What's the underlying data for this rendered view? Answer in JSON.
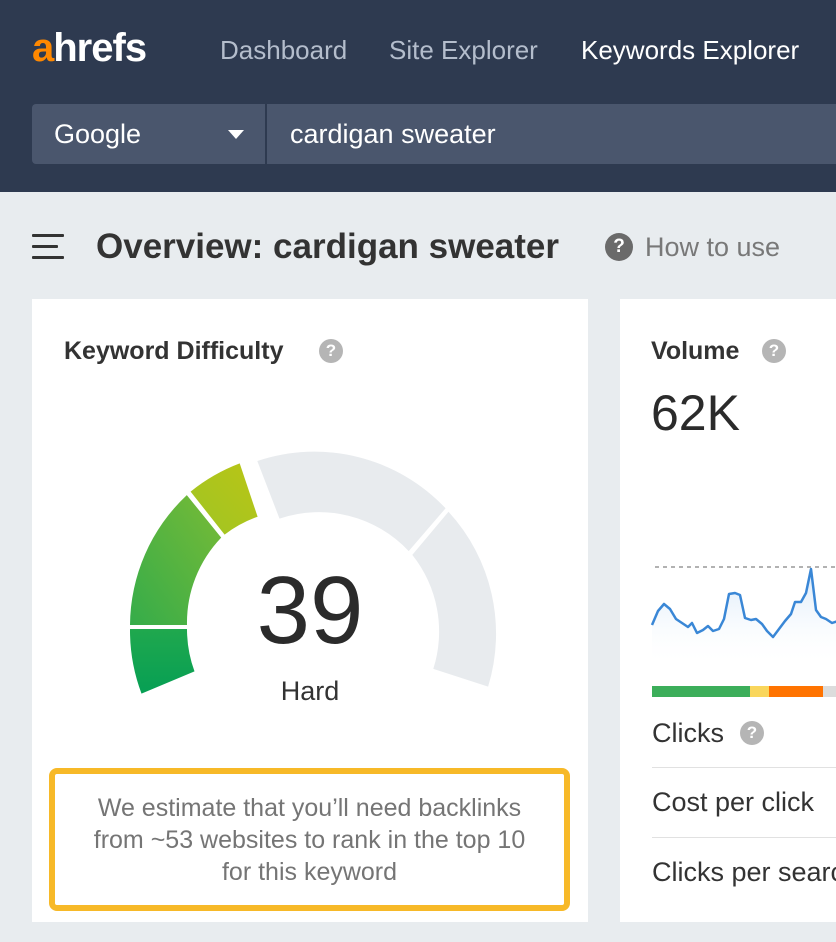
{
  "app": {
    "logo_first": "a",
    "logo_rest": "hrefs",
    "nav": [
      "Dashboard",
      "Site Explorer",
      "Keywords Explorer"
    ],
    "active_nav": "Keywords Explorer"
  },
  "search": {
    "engine": "Google",
    "query": "cardigan sweater"
  },
  "page": {
    "title": "Overview: cardigan sweater",
    "help_icon": "?",
    "help_label": "How to use"
  },
  "keyword_difficulty": {
    "title": "Keyword Difficulty",
    "info_icon": "?",
    "value": "39",
    "rating": "Hard",
    "estimate_line1": "We estimate that you’ll need backlinks",
    "estimate_line2": "from ~53 websites to rank in the top 10",
    "estimate_line3": "for this keyword"
  },
  "volume": {
    "title": "Volume",
    "info_icon": "?",
    "value": "62K",
    "metrics": [
      {
        "label": "Clicks",
        "has_info": true
      },
      {
        "label": "Cost per click",
        "has_info": false
      },
      {
        "label": "Clicks per search",
        "has_info": false
      }
    ]
  },
  "colors": {
    "header_bg": "#2e3a50",
    "logo_accent": "#ff8800",
    "highlight_border": "#f7b928",
    "gauge_track": "#e8ebee",
    "trend_line": "#3a87d6",
    "clicks_bar": [
      "#3cae5a",
      "#f9d65c",
      "#ff7300",
      "#dcdcdc"
    ]
  }
}
